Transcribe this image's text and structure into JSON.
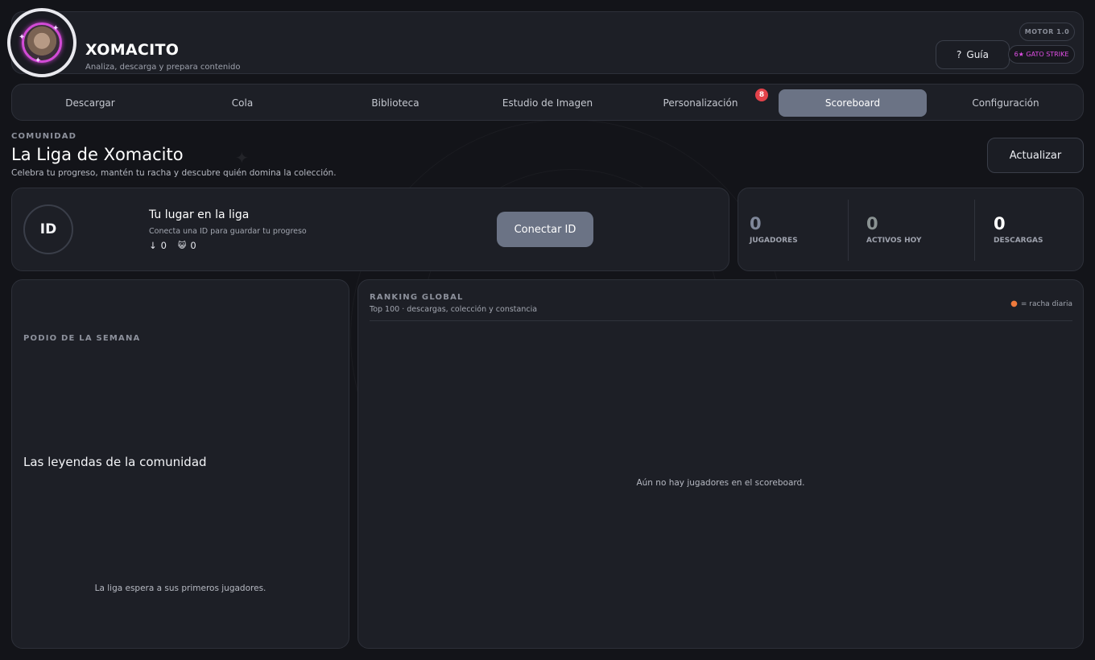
{
  "header": {
    "title": "XOMACITO",
    "subtitle": "Analiza, descarga y prepara contenido",
    "guide_icon": "?",
    "guide_label": "Guía",
    "engine_badge": "MOTOR 1.0",
    "strike_badge": "6★ GATO STRIKE"
  },
  "tabs": [
    {
      "label": "Descargar"
    },
    {
      "label": "Cola"
    },
    {
      "label": "Biblioteca"
    },
    {
      "label": "Estudio de Imagen"
    },
    {
      "label": "Personalización",
      "badge": "8"
    },
    {
      "label": "Scoreboard",
      "active": true
    },
    {
      "label": "Configuración"
    }
  ],
  "section": {
    "eyebrow": "COMUNIDAD",
    "title": "La Liga de Xomacito",
    "description": "Celebra tu progreso, mantén tu racha y descubre quién domina la colección.",
    "refresh_label": "Actualizar"
  },
  "profile": {
    "id_label": "ID",
    "title": "Tu lugar en la liga",
    "subtitle": "Conecta una ID para guardar tu progreso",
    "downloads_icon": "↓",
    "downloads": "0",
    "cats_icon": "😺",
    "cats": "0",
    "connect_label": "Conectar ID"
  },
  "stats": [
    {
      "value": "0",
      "label": "JUGADORES",
      "color": "#7f8799"
    },
    {
      "value": "0",
      "label": "ACTIVOS HOY",
      "color": "#8a9292"
    },
    {
      "value": "0",
      "label": "DESCARGAS",
      "color": "#ffffff"
    }
  ],
  "podium": {
    "eyebrow": "PODIO DE LA SEMANA",
    "title": "Las leyendas de la comunidad",
    "empty": "La liga espera a sus primeros jugadores."
  },
  "ranking": {
    "eyebrow": "RANKING GLOBAL",
    "subtitle": "Top 100 · descargas, colección y constancia",
    "legend": "= racha diaria",
    "empty": "Aún no hay jugadores en el scoreboard."
  },
  "colors": {
    "accent": "#6b7385",
    "badge": "#e2424a",
    "strike": "#e24fe7"
  }
}
